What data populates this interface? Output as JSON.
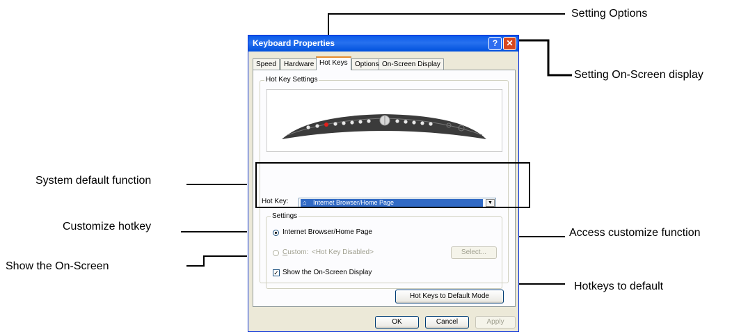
{
  "callouts": {
    "setting_options": "Setting Options",
    "setting_osd": "Setting On-Screen display",
    "system_default": "System default function",
    "customize_hotkey": "Customize hotkey",
    "show_osd": "Show the On-Screen",
    "access_customize": "Access customize function",
    "hotkeys_default": "Hotkeys to default"
  },
  "window": {
    "title": "Keyboard Properties",
    "help_glyph": "?",
    "close_glyph": "✕"
  },
  "tabs": [
    "Speed",
    "Hardware",
    "Hot Keys",
    "Options",
    "On-Screen Display"
  ],
  "active_tab": "Hot Keys",
  "hotkey_settings": {
    "group_label": "Hot Key Settings",
    "hotkey_label": "Hot Key:",
    "hotkey_value": "Internet Browser/Home Page",
    "settings_label": "Settings",
    "default_option": "Internet Browser/Home Page",
    "custom_label": "Custom:",
    "custom_placeholder": "<Hot Key Disabled>",
    "select_button": "Select...",
    "show_osd_checkbox": "Show the On-Screen Display",
    "show_osd_checked": true,
    "default_mode_button": "Hot Keys to Default Mode"
  },
  "footer": {
    "ok": "OK",
    "cancel": "Cancel",
    "apply": "Apply"
  },
  "colors": {
    "titlebar": "#0a5ae9",
    "window_bg": "#ece9d8",
    "selection": "#316ac5",
    "active_tab_accent": "#e68b2c"
  }
}
